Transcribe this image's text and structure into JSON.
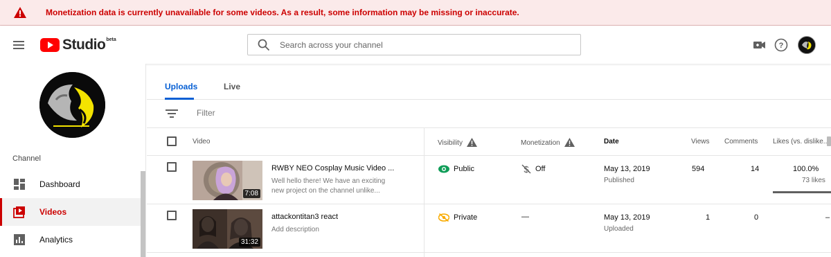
{
  "banner": {
    "message": "Monetization data is currently unavailable for some videos. As a result, some information may be missing or inaccurate.",
    "color": "#cc0000",
    "icon": "warning-icon"
  },
  "header": {
    "logo_text": "Studio",
    "logo_badge": "beta",
    "search_placeholder": "Search across your channel",
    "icons": [
      "menu-icon",
      "create-video-icon",
      "help-icon",
      "account-avatar"
    ]
  },
  "sidebar": {
    "section_label": "Channel",
    "items": [
      {
        "label": "Dashboard",
        "icon": "dashboard-icon",
        "active": false
      },
      {
        "label": "Videos",
        "icon": "videos-icon",
        "active": true
      },
      {
        "label": "Analytics",
        "icon": "analytics-icon",
        "active": false
      }
    ],
    "accent": "#cc0000"
  },
  "tabs": [
    {
      "label": "Uploads",
      "active": true
    },
    {
      "label": "Live",
      "active": false
    }
  ],
  "filter": {
    "placeholder": "Filter"
  },
  "columns": {
    "video": "Video",
    "visibility": "Visibility",
    "monetization": "Monetization",
    "date": "Date",
    "views": "Views",
    "comments": "Comments",
    "likes": "Likes (vs. dislike..."
  },
  "rows": [
    {
      "title": "RWBY NEO Cosplay Music Video ...",
      "description": "Well hello there! We have an exciting new project on the channel unlike...",
      "duration": "7:08",
      "visibility": "Public",
      "visibility_color": "#0f9d58",
      "monetization": "Off",
      "date": "May 13, 2019",
      "date_status": "Published",
      "views": "594",
      "comments": "14",
      "likes_pct": "100.0%",
      "likes_count": "73 likes"
    },
    {
      "title": "attackontitan3 react",
      "description": "Add description",
      "duration": "31:32",
      "visibility": "Private",
      "visibility_color": "#f9ab00",
      "monetization": "—",
      "date": "May 13, 2019",
      "date_status": "Uploaded",
      "views": "1",
      "comments": "0",
      "likes_pct": "–",
      "likes_count": ""
    }
  ]
}
